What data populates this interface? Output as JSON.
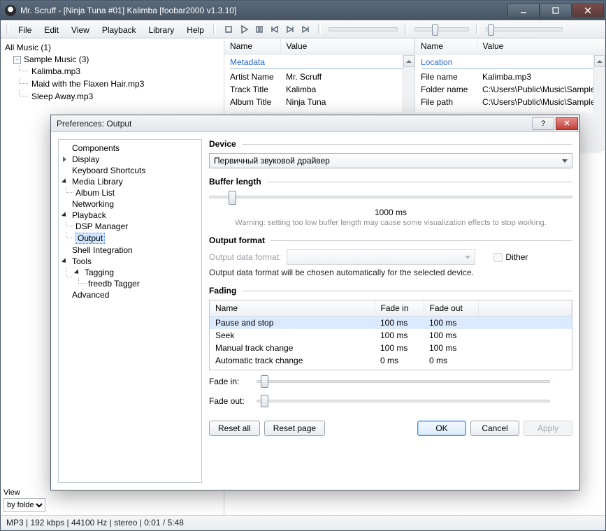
{
  "window": {
    "title": "Mr. Scruff - [Ninja Tuna #01] Kalimba   [foobar2000 v1.3.10]"
  },
  "menubar": [
    "File",
    "Edit",
    "View",
    "Playback",
    "Library",
    "Help"
  ],
  "tree": {
    "root": "All Music (1)",
    "folder": "Sample Music (3)",
    "files": [
      "Kalimba.mp3",
      "Maid with the Flaxen Hair.mp3",
      "Sleep Away.mp3"
    ]
  },
  "props_left": {
    "headers": [
      "Name",
      "Value"
    ],
    "section": "Metadata",
    "rows": [
      [
        "Artist Name",
        "Mr. Scruff"
      ],
      [
        "Track Title",
        "Kalimba"
      ],
      [
        "Album Title",
        "Ninja Tuna"
      ]
    ]
  },
  "props_right": {
    "headers": [
      "Name",
      "Value"
    ],
    "section": "Location",
    "rows": [
      [
        "File name",
        "Kalimba.mp3"
      ],
      [
        "Folder name",
        "C:\\Users\\Public\\Music\\Sample"
      ],
      [
        "File path",
        "C:\\Users\\Public\\Music\\Sample"
      ]
    ]
  },
  "bottom_left": {
    "label": "View",
    "value": "by folder s"
  },
  "status": "MP3 | 192 kbps | 44100 Hz | stereo | 0:01 / 5:48",
  "dialog": {
    "title": "Preferences: Output",
    "tree": {
      "Components": [],
      "Display": [
        "__collapsed__"
      ],
      "Keyboard Shortcuts": [],
      "Media Library": [
        "Album List"
      ],
      "Networking": [],
      "Playback": [
        "DSP Manager",
        "Output"
      ],
      "Shell Integration": [],
      "Tools": {
        "Tagging": [
          "freedb Tagger"
        ]
      },
      "Advanced": []
    },
    "selected_node": "Output",
    "device": {
      "title": "Device",
      "value": "Первичный звуковой драйвер"
    },
    "buffer": {
      "title": "Buffer length",
      "value": "1000 ms",
      "warning": "Warning: setting too low buffer length may cause some visualization effects to stop working."
    },
    "output_format": {
      "title": "Output format",
      "label": "Output data format:",
      "dither": "Dither",
      "note": "Output data format will be chosen automatically for the selected device."
    },
    "fading": {
      "title": "Fading",
      "headers": [
        "Name",
        "Fade in",
        "Fade out"
      ],
      "rows": [
        [
          "Pause and stop",
          "100 ms",
          "100 ms"
        ],
        [
          "Seek",
          "100 ms",
          "100 ms"
        ],
        [
          "Manual track change",
          "100 ms",
          "100 ms"
        ],
        [
          "Automatic track change",
          "0 ms",
          "0 ms"
        ]
      ],
      "fade_in_label": "Fade in:",
      "fade_out_label": "Fade out:"
    },
    "buttons": {
      "reset_all": "Reset all",
      "reset_page": "Reset page",
      "ok": "OK",
      "cancel": "Cancel",
      "apply": "Apply"
    }
  }
}
